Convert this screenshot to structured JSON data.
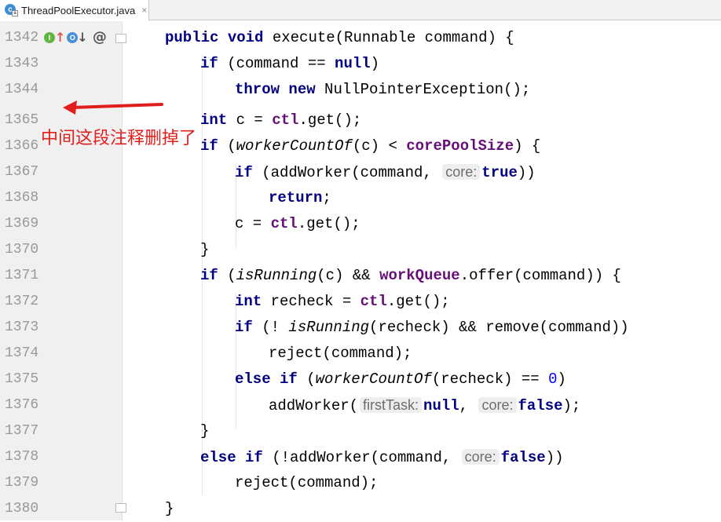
{
  "tab": {
    "label": "ThreadPoolExecutor.java",
    "close": "×",
    "icon": "java-class-icon"
  },
  "annotation": {
    "text": "中间这段注释删掉了",
    "color": "#e01e1e"
  },
  "lines": [
    {
      "num": "1342"
    },
    {
      "num": "1343"
    },
    {
      "num": "1344"
    },
    {
      "num": "1365"
    },
    {
      "num": "1366"
    },
    {
      "num": "1367"
    },
    {
      "num": "1368"
    },
    {
      "num": "1369"
    },
    {
      "num": "1370"
    },
    {
      "num": "1371"
    },
    {
      "num": "1372"
    },
    {
      "num": "1373"
    },
    {
      "num": "1374"
    },
    {
      "num": "1375"
    },
    {
      "num": "1376"
    },
    {
      "num": "1377"
    },
    {
      "num": "1378"
    },
    {
      "num": "1379"
    },
    {
      "num": "1380"
    }
  ],
  "code": {
    "l1342": [
      "public",
      " ",
      "void",
      " execute(Runnable command) {"
    ],
    "l1343": [
      "if",
      " (command == ",
      "null",
      ")"
    ],
    "l1344": [
      "throw",
      " ",
      "new",
      " NullPointerException();"
    ],
    "l1365": [
      "int",
      " c = ",
      "ctl",
      ".get();"
    ],
    "l1366": [
      "if",
      " (",
      "workerCountOf",
      "(c) < ",
      "corePoolSize",
      ") {"
    ],
    "l1367": [
      "if",
      " (addWorker(command, ",
      "core:",
      " ",
      "true",
      "))"
    ],
    "l1368": [
      "return",
      ";"
    ],
    "l1369": [
      "c = ",
      "ctl",
      ".get();"
    ],
    "l1370": [
      "}"
    ],
    "l1371": [
      "if",
      " (",
      "isRunning",
      "(c) && ",
      "workQueue",
      ".offer(command)) {"
    ],
    "l1372": [
      "int",
      " recheck = ",
      "ctl",
      ".get();"
    ],
    "l1373": [
      "if",
      " (! ",
      "isRunning",
      "(recheck) && remove(command))"
    ],
    "l1374": [
      "reject(command);"
    ],
    "l1375": [
      "else",
      " ",
      "if",
      " (",
      "workerCountOf",
      "(recheck) == ",
      "0",
      ")"
    ],
    "l1376": [
      "addWorker(",
      "firstTask:",
      "null",
      ", ",
      "core:",
      "false",
      ");"
    ],
    "l1377": [
      "}"
    ],
    "l1378": [
      "else",
      " ",
      "if",
      " (!addWorker(command, ",
      "core:",
      "false",
      "))"
    ],
    "l1379": [
      "reject(command);"
    ],
    "l1380": [
      "}"
    ]
  }
}
